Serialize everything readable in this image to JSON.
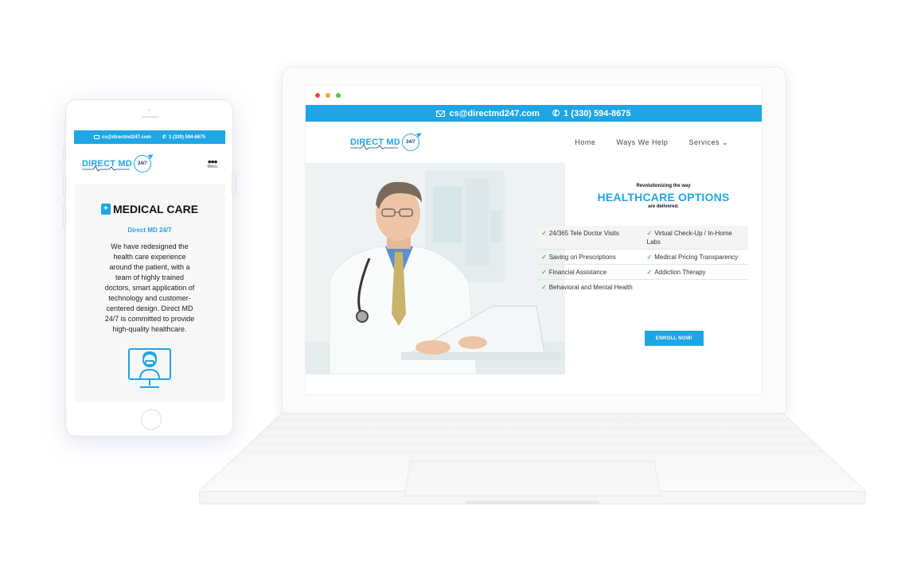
{
  "laptop": {
    "topbar": {
      "email": "cs@directmd247.com",
      "phone": "1 (330) 594-8675"
    },
    "logo": {
      "name": "DIRECT MD",
      "badge": "24/7"
    },
    "nav": {
      "items": [
        "Home",
        "Ways We Help",
        "Services"
      ]
    },
    "hero": {
      "pre": "Revolutionizing the way",
      "title": "HEALTHCARE OPTIONS",
      "post": "are delivered.",
      "features": [
        "24/365 Tele Doctor Visits",
        "Virtual Check-Up / In-Home Labs",
        "Saving on Prescriptions",
        "Medical Pricing Transparency",
        "Financial Assistance",
        "Addiction Therapy",
        "Behavioral and Mental Health"
      ],
      "cta": "ENROLL NOW!"
    }
  },
  "phone": {
    "topbar": {
      "email": "cs@directmd247.com",
      "phone": "1 (330) 594-8675"
    },
    "logo": {
      "name": "DIRECT MD",
      "badge": "24/7"
    },
    "menu_label": "Menu",
    "title": "MEDICAL CARE",
    "subtitle": "Direct MD 24/7",
    "description": "We have redesigned the health care experience around the patient, with a team of highly trained doctors, smart application of technology and customer-centered design. Direct MD 24/7 is committed to provide high-quality healthcare."
  },
  "colors": {
    "brand_blue": "#1fa5e4",
    "check_green": "#4fc444",
    "navy": "#1e3b6d"
  },
  "icons": [
    "mail-icon",
    "phone-icon",
    "chevron-down-icon",
    "check-icon",
    "medical-kit-icon",
    "doctor-monitor-icon",
    "menu-dots-icon"
  ]
}
